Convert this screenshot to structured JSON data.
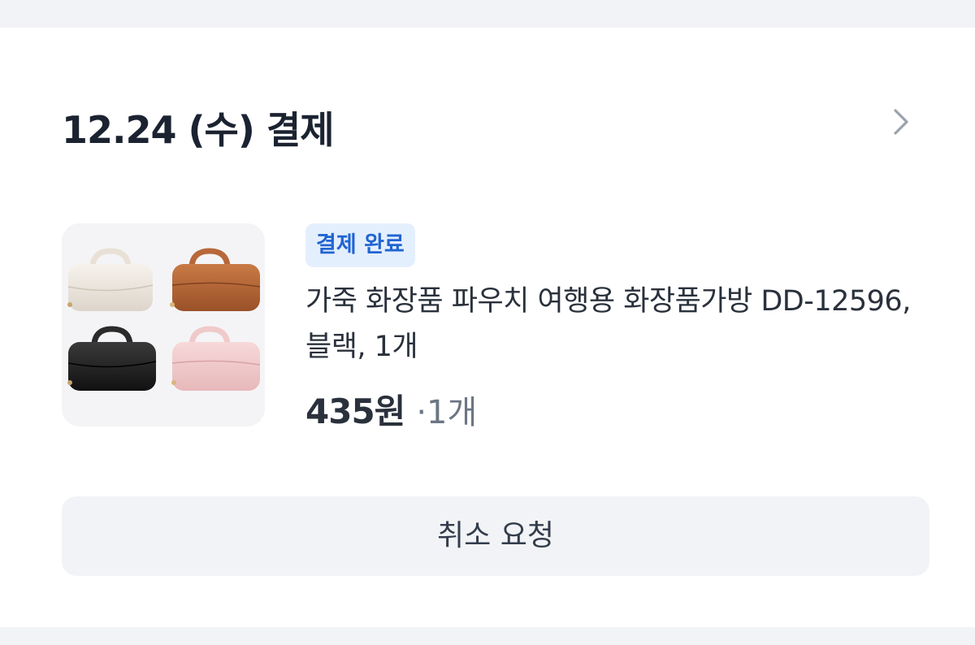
{
  "order": {
    "date_title": "12.24 (수) 결제",
    "status_badge": "결제 완료",
    "product_name": "가죽 화장품 파우치 여행용 화장품가방 DD-12596, 블랙, 1개",
    "price": "435원",
    "quantity": "·1개",
    "cancel_label": "취소 요청",
    "product_image": "cosmetic-pouch-set-image"
  },
  "icons": {
    "header_arrow": "chevron-right-icon"
  },
  "colors": {
    "badge_bg": "#e4effd",
    "badge_text": "#2164d2",
    "page_bg": "#f2f3f6",
    "card_bg": "#ffffff",
    "button_bg": "#f2f3f6"
  }
}
